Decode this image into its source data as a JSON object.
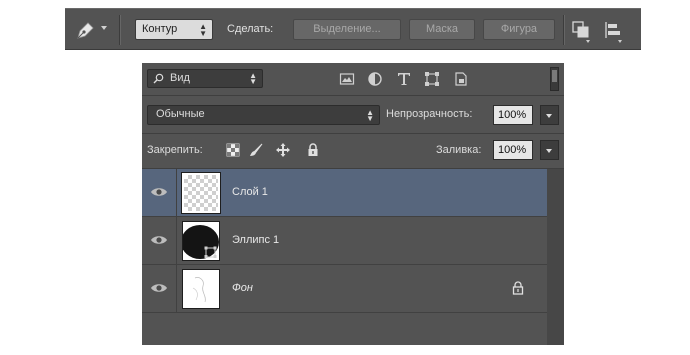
{
  "options_bar": {
    "tool_icon": "pen-tool-icon",
    "mode": "Контур",
    "make_label": "Сделать:",
    "buttons": [
      "Выделение...",
      "Маска",
      "Фигура"
    ],
    "icons": [
      "path-operations-icon",
      "path-alignment-icon"
    ]
  },
  "layers_panel": {
    "filter": {
      "search_icon": "search-icon",
      "kind": "Вид",
      "filter_icons": [
        "pixel-layer-filter-icon",
        "adjustment-layer-filter-icon",
        "type-layer-filter-icon",
        "shape-layer-filter-icon",
        "smart-object-filter-icon"
      ]
    },
    "blend_mode": "Обычные",
    "opacity_label": "Непрозрачность:",
    "opacity_value": "100%",
    "lock_label": "Закрепить:",
    "lock_icons": [
      "lock-transparency-icon",
      "lock-pixels-icon",
      "lock-position-icon",
      "lock-all-icon"
    ],
    "fill_label": "Заливка:",
    "fill_value": "100%",
    "layers": [
      {
        "name": "Слой 1",
        "selected": true,
        "visible": true,
        "thumb": "transparent",
        "locked": false
      },
      {
        "name": "Эллипс 1",
        "selected": false,
        "visible": true,
        "thumb": "vector-mask",
        "locked": false
      },
      {
        "name": "Фон",
        "selected": false,
        "visible": true,
        "thumb": "background",
        "locked": true
      }
    ]
  }
}
